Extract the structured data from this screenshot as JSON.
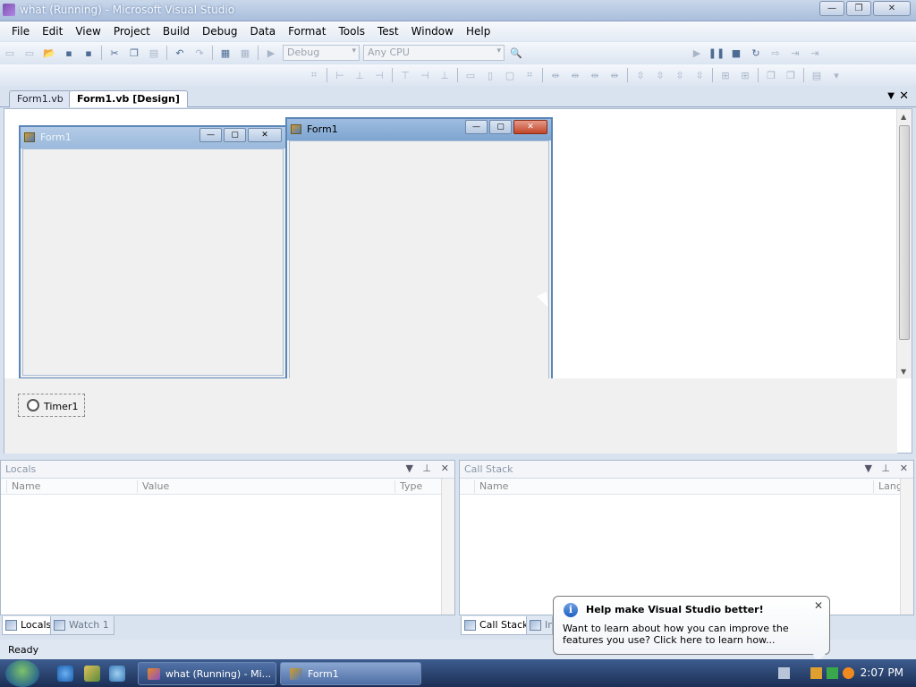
{
  "window": {
    "title": "what (Running) - Microsoft Visual Studio",
    "controls": [
      "—",
      "❐",
      "✕"
    ]
  },
  "menu": [
    "File",
    "Edit",
    "View",
    "Project",
    "Build",
    "Debug",
    "Data",
    "Format",
    "Tools",
    "Test",
    "Window",
    "Help"
  ],
  "toolbar": {
    "config": "Debug",
    "platform": "Any CPU"
  },
  "tabs": [
    "Form1.vb",
    "Form1.vb [Design]"
  ],
  "design": {
    "form_back_title": "Form1",
    "form_front_title": "Form1",
    "timer_label": "Timer1"
  },
  "locals": {
    "title": "Locals",
    "columns": [
      "Name",
      "Value",
      "Type"
    ]
  },
  "callstack": {
    "title": "Call Stack",
    "columns": [
      "Name",
      "Lang"
    ]
  },
  "pane_tabs_left": [
    "Locals",
    "Watch 1"
  ],
  "pane_tabs_right": [
    "Call Stack",
    "Im"
  ],
  "status": "Ready",
  "balloon": {
    "title": "Help make Visual Studio better!",
    "body": "Want to learn about how you can improve the features you use? Click here to learn how..."
  },
  "taskbar": {
    "items": [
      "what (Running) - Mi...",
      "Form1"
    ],
    "clock": "2:07 PM"
  },
  "colors": {
    "accent": "#5a86b8",
    "close_red": "#c14628",
    "taskbar": "#1b2f55"
  }
}
